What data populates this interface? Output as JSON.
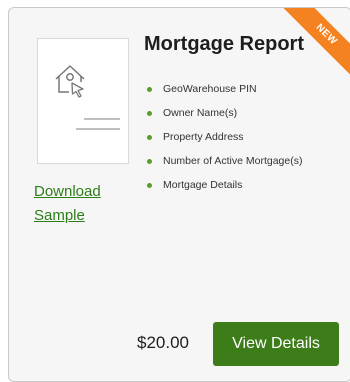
{
  "card": {
    "badge": "NEW",
    "title": "Mortgage Report",
    "sample_link": "Download Sample",
    "features": [
      "GeoWarehouse PIN",
      "Owner Name(s)",
      "Property Address",
      "Number of Active Mortgage(s)",
      "Mortgage Details"
    ],
    "price": "$20.00",
    "button_label": "View Details",
    "thumbnail_icon": "house-cursor-icon"
  },
  "colors": {
    "accent_green": "#3c7d1a",
    "link_green": "#2e7d1a",
    "bullet_green": "#5a9e2c",
    "badge_orange": "#f58220"
  }
}
